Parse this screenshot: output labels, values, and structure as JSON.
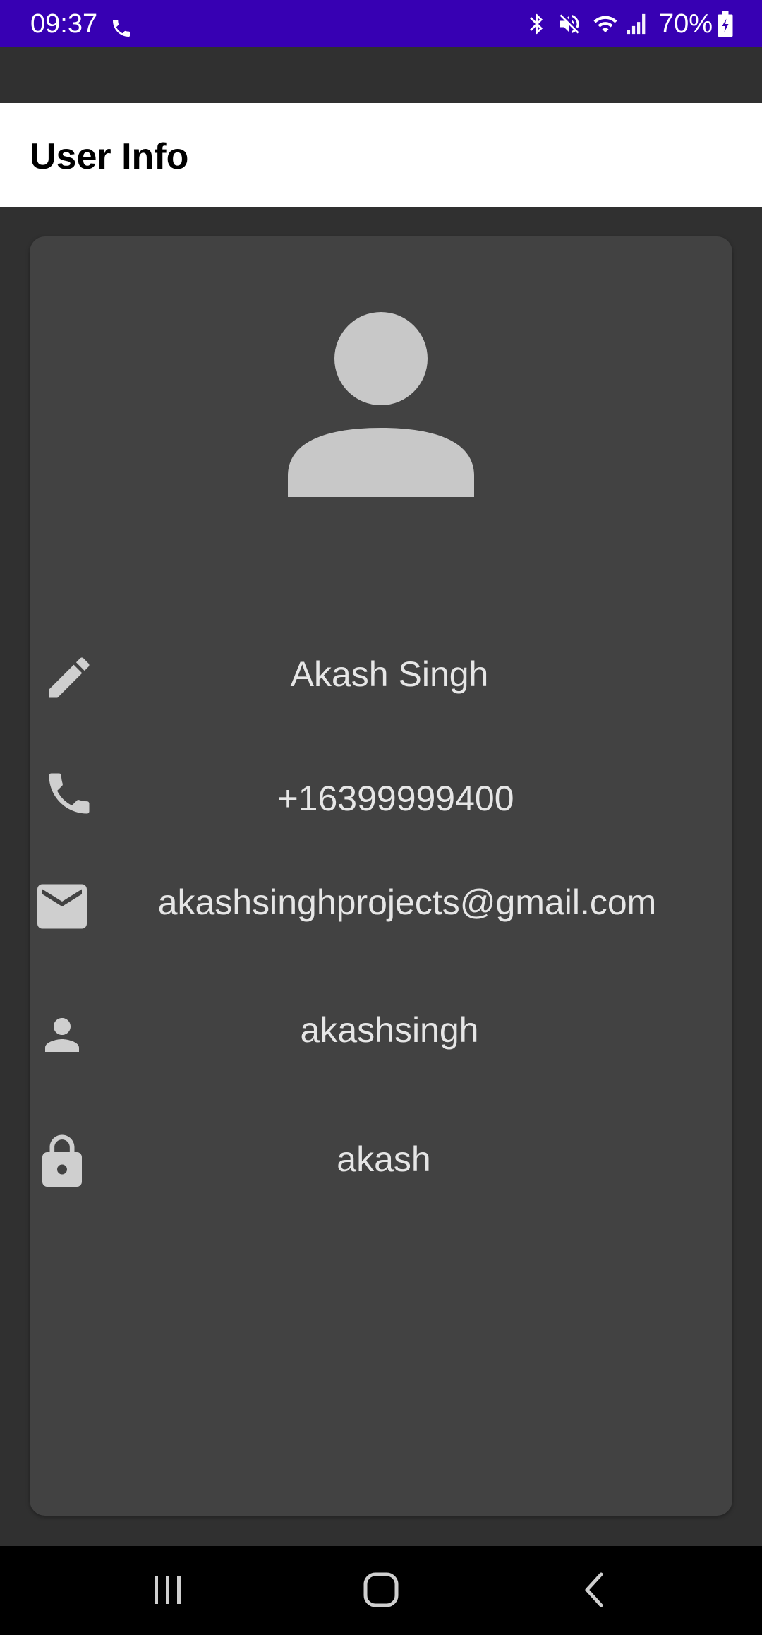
{
  "status_bar": {
    "time": "09:37",
    "battery_percent": "70%",
    "background_color": "#3700b3",
    "icons": [
      "phone-call-icon",
      "bluetooth-icon",
      "mute-icon",
      "wifi-icon",
      "signal-icon",
      "battery-charging-icon"
    ]
  },
  "app_bar": {
    "title": "User Info"
  },
  "profile": {
    "avatar_icon": "account-circle-icon",
    "fields": [
      {
        "icon": "edit-icon",
        "value": "Akash Singh"
      },
      {
        "icon": "phone-icon",
        "value": "+16399999400"
      },
      {
        "icon": "email-icon",
        "value": "akashsinghprojects@gmail.com"
      },
      {
        "icon": "person-icon",
        "value": "akashsingh"
      },
      {
        "icon": "lock-icon",
        "value": "akash"
      }
    ]
  },
  "nav_bar": {
    "buttons": [
      "recent-apps-icon",
      "home-icon",
      "back-icon"
    ]
  },
  "colors": {
    "background": "#303030",
    "card": "#424242",
    "icon": "#cfcfcf",
    "text": "#e6e6e6"
  }
}
